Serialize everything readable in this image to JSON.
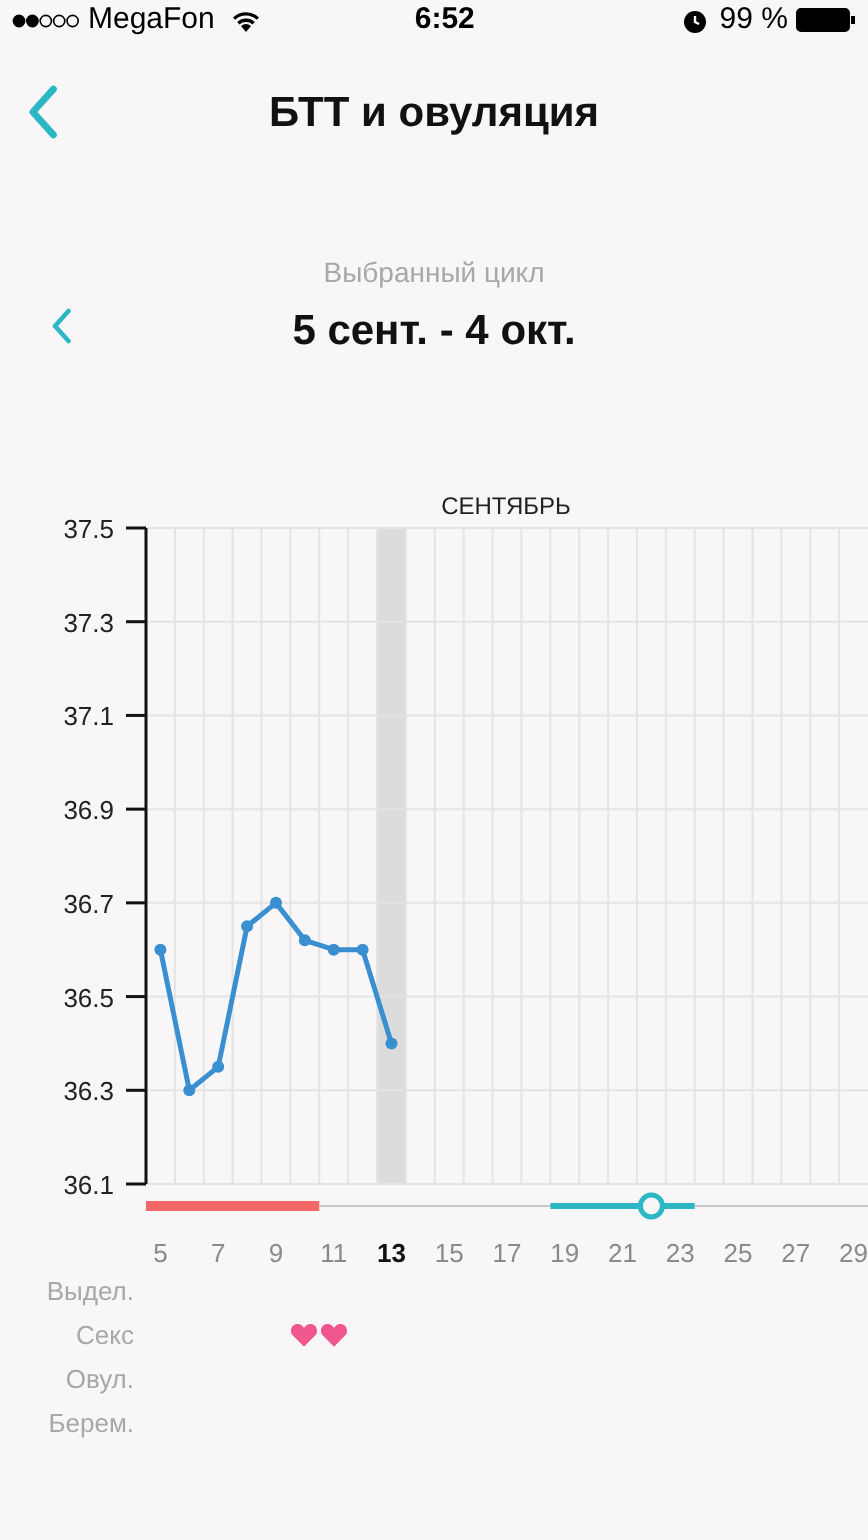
{
  "status_bar": {
    "carrier": "MegaFon",
    "time": "6:52",
    "battery": "99 %"
  },
  "nav": {
    "title": "БТТ и овуляция"
  },
  "cycle": {
    "caption": "Выбранный цикл",
    "range": "5 сент. - 4 окт."
  },
  "chart": {
    "chart_data": {
      "type": "line",
      "title": "СЕНТЯБРЬ",
      "x": [
        5,
        6,
        7,
        8,
        9,
        10,
        11,
        12,
        13
      ],
      "series": [
        {
          "color": "#3a8fd0",
          "marker": "circle",
          "values": [
            36.6,
            36.3,
            36.35,
            36.65,
            36.7,
            36.62,
            36.6,
            36.6,
            36.4
          ]
        }
      ],
      "xlim": [
        4.5,
        29.5
      ],
      "ylim": [
        36.1,
        37.5
      ],
      "grid": true,
      "bands": [
        {
          "axis": "x",
          "from": 12.5,
          "to": 13.5,
          "color": "#dcdcdc"
        }
      ],
      "xticks": [
        5,
        7,
        9,
        11,
        13,
        15,
        17,
        19,
        21,
        23,
        25,
        27,
        29
      ],
      "yticks": [
        {
          "value": 37.5,
          "label": "37.5"
        },
        {
          "value": 37.3,
          "label": "37.3"
        },
        {
          "value": 37.1,
          "label": "37.1"
        },
        {
          "value": 36.9,
          "label": "36.9"
        },
        {
          "value": 36.7,
          "label": "36.7"
        },
        {
          "value": 36.5,
          "label": "36.5"
        },
        {
          "value": 36.3,
          "label": "36.3"
        },
        {
          "value": 36.1,
          "label": "36.1"
        }
      ]
    },
    "tick_states": [
      {
        "selected": false
      },
      {
        "selected": false
      },
      {
        "selected": false
      },
      {
        "selected": false
      },
      {
        "selected": true
      },
      {
        "selected": false
      },
      {
        "selected": false
      },
      {
        "selected": false
      },
      {
        "selected": false
      },
      {
        "selected": false
      },
      {
        "selected": false
      },
      {
        "selected": false
      },
      {
        "selected": false
      }
    ],
    "days": [
      {
        "kind": "period",
        "sex": false
      },
      {
        "kind": "period",
        "sex": false
      },
      {
        "kind": "period",
        "sex": false
      },
      {
        "kind": "period",
        "sex": false
      },
      {
        "kind": "period",
        "sex": false
      },
      {
        "kind": "period",
        "sex": true
      },
      {
        "kind": "plain",
        "sex": true
      },
      {
        "kind": "plain",
        "sex": false
      },
      {
        "kind": "plain",
        "sex": false
      },
      {
        "kind": "plain",
        "sex": false
      },
      {
        "kind": "plain",
        "sex": false
      },
      {
        "kind": "plain",
        "sex": false
      },
      {
        "kind": "plain",
        "sex": false
      },
      {
        "kind": "plain",
        "sex": false
      },
      {
        "kind": "fertile",
        "sex": false
      },
      {
        "kind": "fertile",
        "sex": false
      },
      {
        "kind": "fertile",
        "sex": false
      },
      {
        "kind": "ovulation",
        "sex": false
      },
      {
        "kind": "fertile",
        "sex": false
      },
      {
        "kind": "plain",
        "sex": false
      },
      {
        "kind": "plain",
        "sex": false
      },
      {
        "kind": "plain",
        "sex": false
      },
      {
        "kind": "plain",
        "sex": false
      },
      {
        "kind": "plain",
        "sex": false
      },
      {
        "kind": "plain",
        "sex": false
      }
    ],
    "rows": [
      {
        "label": "Выдел.",
        "kind": "discharge"
      },
      {
        "label": "Секс",
        "kind": "sex"
      },
      {
        "label": "Овул.",
        "kind": "ovulation_test"
      },
      {
        "label": "Берем.",
        "kind": "pregnancy_test"
      }
    ]
  }
}
